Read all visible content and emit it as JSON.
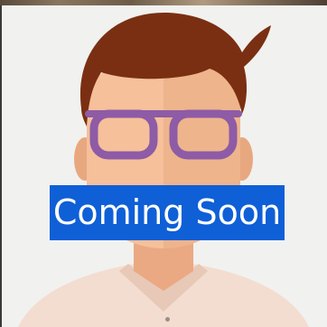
{
  "placeholder": {
    "banner_text": "Coming Soon",
    "banner_color": "#0f5fd7",
    "banner_text_color": "#ffffff",
    "icon": "person-avatar-with-glasses-icon"
  },
  "colors": {
    "background": "#f1f1ef",
    "hair": "#7a2f12",
    "skin": "#f5c09a",
    "skin_shadow": "#e8a87f",
    "glasses": "#8e5ba6",
    "shirt": "#f3ddd0"
  }
}
